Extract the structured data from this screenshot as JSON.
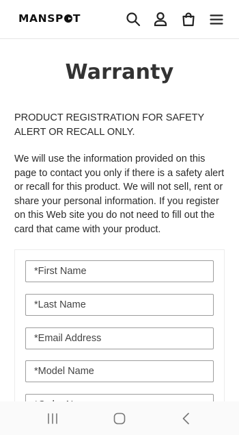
{
  "header": {
    "logo_text_left": "MANSP",
    "logo_text_right": "T",
    "icons": [
      "search-icon",
      "account-icon",
      "cart-icon",
      "menu-icon"
    ]
  },
  "page": {
    "title": "Warranty",
    "paragraph_1": "PRODUCT REGISTRATION FOR SAFETY ALERT OR RECALL ONLY.",
    "paragraph_2": "We will use the information provided on this page to contact you only if there is a safety alert or recall for this product. We will not sell, rent or share your personal information. If you register on this Web site you do not need to fill out the card that came with your product."
  },
  "form": {
    "first_name_placeholder": "*First Name",
    "last_name_placeholder": "*Last Name",
    "email_placeholder": "*Email Address",
    "model_name_placeholder": "*Model Name",
    "order_no_placeholder": "*Order No"
  },
  "system_nav": {
    "icons": [
      "recent-apps-icon",
      "home-icon",
      "back-icon"
    ]
  }
}
